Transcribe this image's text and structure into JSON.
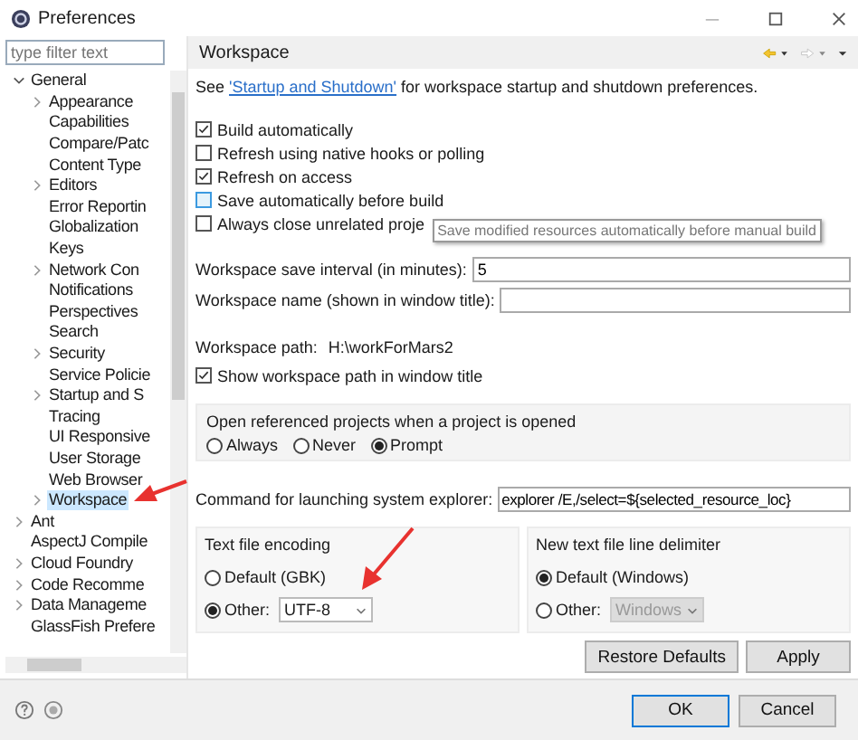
{
  "window": {
    "title": "Preferences"
  },
  "filter": {
    "placeholder": "type filter text"
  },
  "tree": [
    {
      "label": "General",
      "expanded": true,
      "selected": false,
      "children": [
        {
          "label": "Appearance",
          "expanded": false,
          "selected": false
        },
        {
          "label": "Capabilities",
          "selected": false
        },
        {
          "label": "Compare/Patc",
          "selected": false
        },
        {
          "label": "Content Type",
          "selected": false
        },
        {
          "label": "Editors",
          "expanded": false,
          "selected": false
        },
        {
          "label": "Error Reportin",
          "selected": false
        },
        {
          "label": "Globalization",
          "selected": false
        },
        {
          "label": "Keys",
          "selected": false
        },
        {
          "label": "Network Con",
          "expanded": false,
          "selected": false
        },
        {
          "label": "Notifications",
          "selected": false
        },
        {
          "label": "Perspectives",
          "selected": false
        },
        {
          "label": "Search",
          "selected": false
        },
        {
          "label": "Security",
          "expanded": false,
          "selected": false
        },
        {
          "label": "Service Policie",
          "selected": false
        },
        {
          "label": "Startup and S",
          "expanded": false,
          "selected": false
        },
        {
          "label": "Tracing",
          "selected": false
        },
        {
          "label": "UI Responsive",
          "selected": false
        },
        {
          "label": "User Storage",
          "selected": false
        },
        {
          "label": "Web Browser",
          "selected": false
        },
        {
          "label": "Workspace",
          "expanded": false,
          "selected": true
        }
      ]
    },
    {
      "label": "Ant",
      "expanded": false,
      "selected": false
    },
    {
      "label": "AspectJ Compile",
      "selected": false
    },
    {
      "label": "Cloud Foundry",
      "expanded": false,
      "selected": false
    },
    {
      "label": "Code Recomme",
      "expanded": false,
      "selected": false
    },
    {
      "label": "Data Manageme",
      "expanded": false,
      "selected": false
    },
    {
      "label": "GlassFish Prefere",
      "selected": false
    }
  ],
  "page": {
    "title": "Workspace",
    "intro": {
      "before": "See ",
      "link": "'Startup and Shutdown'",
      "after": " for workspace startup and shutdown preferences."
    },
    "checkboxes": [
      {
        "label": "Build automatically",
        "checked": true,
        "hovered": false
      },
      {
        "label": "Refresh using native hooks or polling",
        "checked": false,
        "hovered": false
      },
      {
        "label": "Refresh on access",
        "checked": true,
        "hovered": false
      },
      {
        "label": "Save automatically before build",
        "checked": false,
        "hovered": true
      },
      {
        "label": "Always close unrelated proje",
        "checked": false,
        "hovered": false
      }
    ],
    "tooltip": "Save modified resources automatically before manual build",
    "fields": [
      {
        "label": "Workspace save interval (in minutes):",
        "value": "5"
      },
      {
        "label": "Workspace name (shown in window title):"
      }
    ],
    "path": {
      "label": "Workspace path:",
      "value": "H:\\workForMars2"
    },
    "show_path": {
      "label": "Show workspace path in window title",
      "checked": true
    },
    "open_projects": {
      "title": "Open referenced projects when a project is opened",
      "options": [
        {
          "label": "Always",
          "selected": false
        },
        {
          "label": "Never",
          "selected": false
        },
        {
          "label": "Prompt",
          "selected": true
        }
      ]
    },
    "command": {
      "label": "Command for launching system explorer:",
      "value": "explorer /E,/select=${selected_resource_loc}"
    },
    "encoding": {
      "title": "Text file encoding",
      "options": [
        {
          "label": "Default (GBK)",
          "selected": false
        },
        {
          "label": "Other:",
          "selected": true,
          "dropdown": "UTF-8",
          "disabled": false
        }
      ]
    },
    "delimiter": {
      "title": "New text file line delimiter",
      "options": [
        {
          "label": "Default (Windows)",
          "selected": true
        },
        {
          "label": "Other:",
          "selected": false,
          "dropdown": "Windows",
          "disabled": true
        }
      ]
    },
    "buttons": [
      "Restore Defaults",
      "Apply"
    ]
  },
  "dialog_buttons": [
    {
      "label": "OK",
      "default": true
    },
    {
      "label": "Cancel",
      "default": false
    }
  ]
}
